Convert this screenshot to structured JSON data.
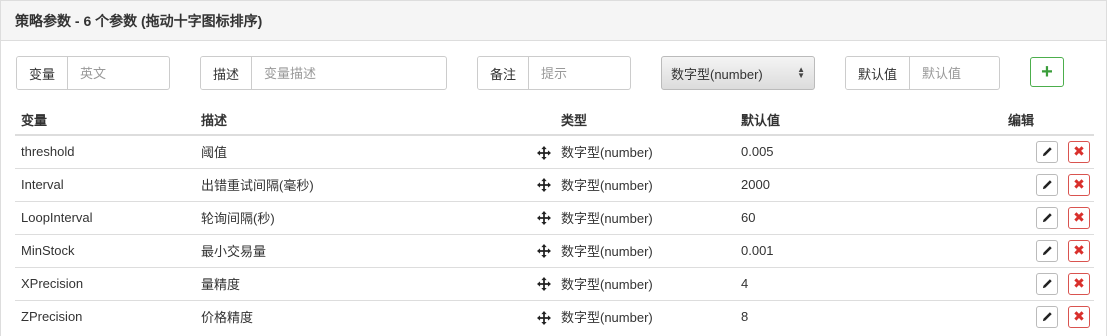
{
  "panel": {
    "title": "策略参数 - 6 个参数 (拖动十字图标排序)"
  },
  "form": {
    "variable": {
      "label": "变量",
      "placeholder": "英文"
    },
    "description": {
      "label": "描述",
      "placeholder": "变量描述"
    },
    "note": {
      "label": "备注",
      "placeholder": "提示"
    },
    "type_select": {
      "value": "数字型(number)"
    },
    "default": {
      "label": "默认值",
      "placeholder": "默认值"
    },
    "add_button": {
      "icon": "plus-icon",
      "color": "#3a9d3a"
    }
  },
  "table": {
    "headers": {
      "variable": "变量",
      "description": "描述",
      "type": "类型",
      "default": "默认值",
      "edit": "编辑"
    },
    "rows": [
      {
        "variable": "threshold",
        "description": "阈值",
        "type": "数字型(number)",
        "default": "0.005"
      },
      {
        "variable": "Interval",
        "description": "出错重试间隔(毫秒)",
        "type": "数字型(number)",
        "default": "2000"
      },
      {
        "variable": "LoopInterval",
        "description": "轮询间隔(秒)",
        "type": "数字型(number)",
        "default": "60"
      },
      {
        "variable": "MinStock",
        "description": "最小交易量",
        "type": "数字型(number)",
        "default": "0.001"
      },
      {
        "variable": "XPrecision",
        "description": "量精度",
        "type": "数字型(number)",
        "default": "4"
      },
      {
        "variable": "ZPrecision",
        "description": "价格精度",
        "type": "数字型(number)",
        "default": "8"
      }
    ]
  },
  "colors": {
    "delete": "#d9302c",
    "add": "#3a9d3a",
    "heading_bg": "#f5f5f5"
  }
}
